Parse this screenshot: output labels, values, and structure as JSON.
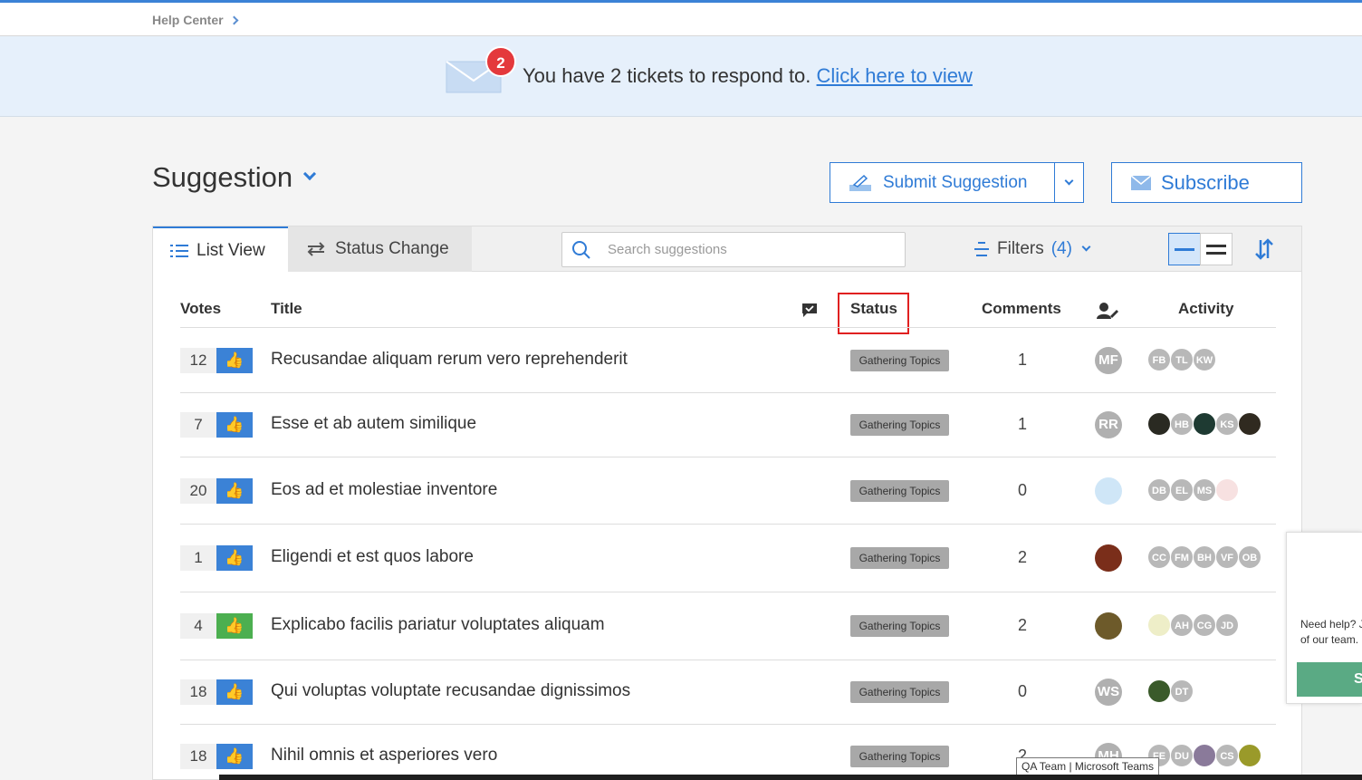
{
  "breadcrumb": {
    "label": "Help Center"
  },
  "banner": {
    "badge_count": "2",
    "message": "You have 2 tickets to respond to.",
    "link": "Click here to view"
  },
  "page": {
    "title": "Suggestion"
  },
  "actions": {
    "submit": "Submit Suggestion",
    "subscribe": "Subscribe"
  },
  "tabs": {
    "list_view": "List View",
    "status_change": "Status Change"
  },
  "search": {
    "placeholder": "Search suggestions"
  },
  "filters": {
    "label": "Filters",
    "count": "(4)"
  },
  "columns": {
    "votes": "Votes",
    "title": "Title",
    "status": "Status",
    "comments": "Comments",
    "activity": "Activity"
  },
  "rows": [
    {
      "votes": "12",
      "title": "Recusandae aliquam rerum vero reprehenderit",
      "status": "Gathering Topics",
      "comments": "1",
      "owner": "MF",
      "activity": [
        "FB",
        "TL",
        "KW"
      ]
    },
    {
      "votes": "7",
      "title": "Esse et ab autem similique",
      "status": "Gathering Topics",
      "comments": "1",
      "owner": "RR",
      "activity": [
        "",
        "HB",
        "",
        "KS",
        ""
      ]
    },
    {
      "votes": "20",
      "title": "Eos ad et molestiae inventore",
      "status": "Gathering Topics",
      "comments": "0",
      "owner": "",
      "activity": [
        "DB",
        "EL",
        "MS",
        ""
      ]
    },
    {
      "votes": "1",
      "title": "Eligendi et est quos labore",
      "status": "Gathering Topics",
      "comments": "2",
      "owner": "",
      "activity": [
        "CC",
        "FM",
        "BH",
        "VF",
        "OB"
      ]
    },
    {
      "votes": "4",
      "title": "Explicabo facilis pariatur voluptates aliquam",
      "status": "Gathering Topics",
      "comments": "2",
      "owner": "",
      "activity": [
        "",
        "AH",
        "CG",
        "JD"
      ]
    },
    {
      "votes": "18",
      "title": "Qui voluptas voluptate recusandae dignissimos",
      "status": "Gathering Topics",
      "comments": "0",
      "owner": "WS",
      "activity": [
        "",
        "DT"
      ]
    },
    {
      "votes": "18",
      "title": "Nihil omnis et asperiores vero",
      "status": "Gathering Topics",
      "comments": "2",
      "owner": "MH",
      "activity": [
        "FE",
        "DU",
        "",
        "CS",
        ""
      ]
    }
  ],
  "help_widget": {
    "line1": "Need help? J",
    "line2": "of our team.",
    "button": "S"
  },
  "tooltip": "QA Team | Microsoft Teams",
  "colors": {
    "accent": "#2f7bd6",
    "vote_blue": "#3b82d6",
    "vote_green": "#4caf50",
    "badge_red": "#e4393c"
  }
}
